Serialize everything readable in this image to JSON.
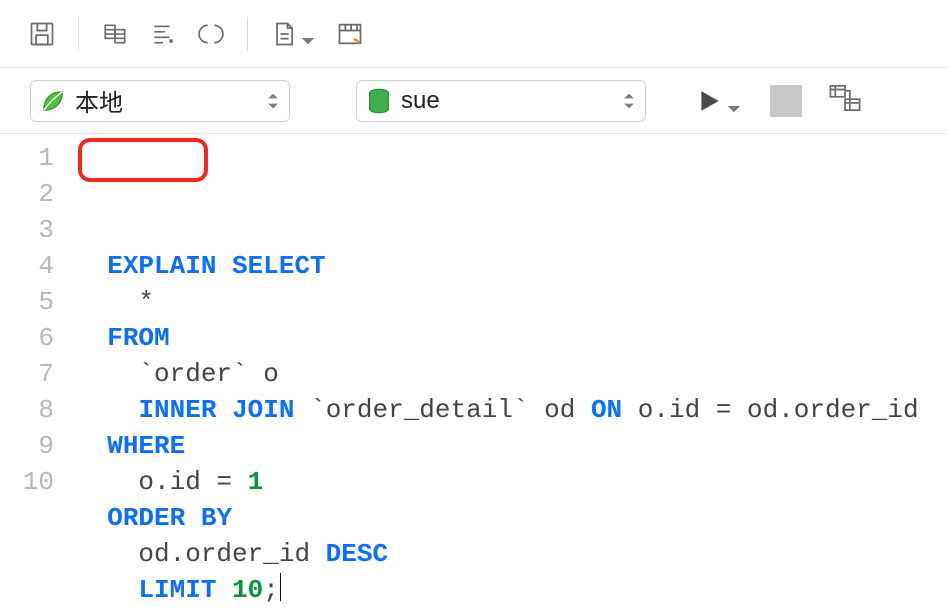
{
  "toolbar": {
    "icons": [
      "save-icon",
      "copy-tables-icon",
      "format-sql-icon",
      "parentheses-icon",
      "new-query-icon",
      "schedule-query-icon"
    ]
  },
  "connection": {
    "combo1": {
      "icon": "leaf-icon",
      "label": "本地"
    },
    "combo2": {
      "icon": "database-icon",
      "label": "sue"
    },
    "run": "run-button",
    "stop": "stop-button",
    "layout": "layout-button"
  },
  "code": {
    "lines": [
      1,
      2,
      3,
      4,
      5,
      6,
      7,
      8,
      9,
      10
    ],
    "tokens": [
      [
        {
          "t": "EXPLAIN",
          "c": "kw"
        },
        {
          "t": " ",
          "c": "id"
        },
        {
          "t": "SELECT",
          "c": "kw"
        }
      ],
      [
        {
          "t": "  *",
          "c": "id"
        }
      ],
      [
        {
          "t": "FROM",
          "c": "kw"
        }
      ],
      [
        {
          "t": "  `order` o",
          "c": "id"
        }
      ],
      [
        {
          "t": "  ",
          "c": "id"
        },
        {
          "t": "INNER",
          "c": "kw"
        },
        {
          "t": " ",
          "c": "id"
        },
        {
          "t": "JOIN",
          "c": "kw"
        },
        {
          "t": " `order_detail` od ",
          "c": "id"
        },
        {
          "t": "ON",
          "c": "kw"
        },
        {
          "t": " o.id = od.order_id",
          "c": "id"
        }
      ],
      [
        {
          "t": "WHERE",
          "c": "kw"
        }
      ],
      [
        {
          "t": "  o.id = ",
          "c": "id"
        },
        {
          "t": "1",
          "c": "num"
        }
      ],
      [
        {
          "t": "ORDER",
          "c": "kw"
        },
        {
          "t": " ",
          "c": "id"
        },
        {
          "t": "BY",
          "c": "kw"
        }
      ],
      [
        {
          "t": "  od.order_id ",
          "c": "id"
        },
        {
          "t": "DESC",
          "c": "kw"
        }
      ],
      [
        {
          "t": "  ",
          "c": "id"
        },
        {
          "t": "LIMIT",
          "c": "kw"
        },
        {
          "t": " ",
          "c": "id"
        },
        {
          "t": "10",
          "c": "num"
        },
        {
          "t": ";",
          "c": "punc"
        }
      ]
    ],
    "highlight_word": "EXPLAIN",
    "cursor_line": 10
  }
}
